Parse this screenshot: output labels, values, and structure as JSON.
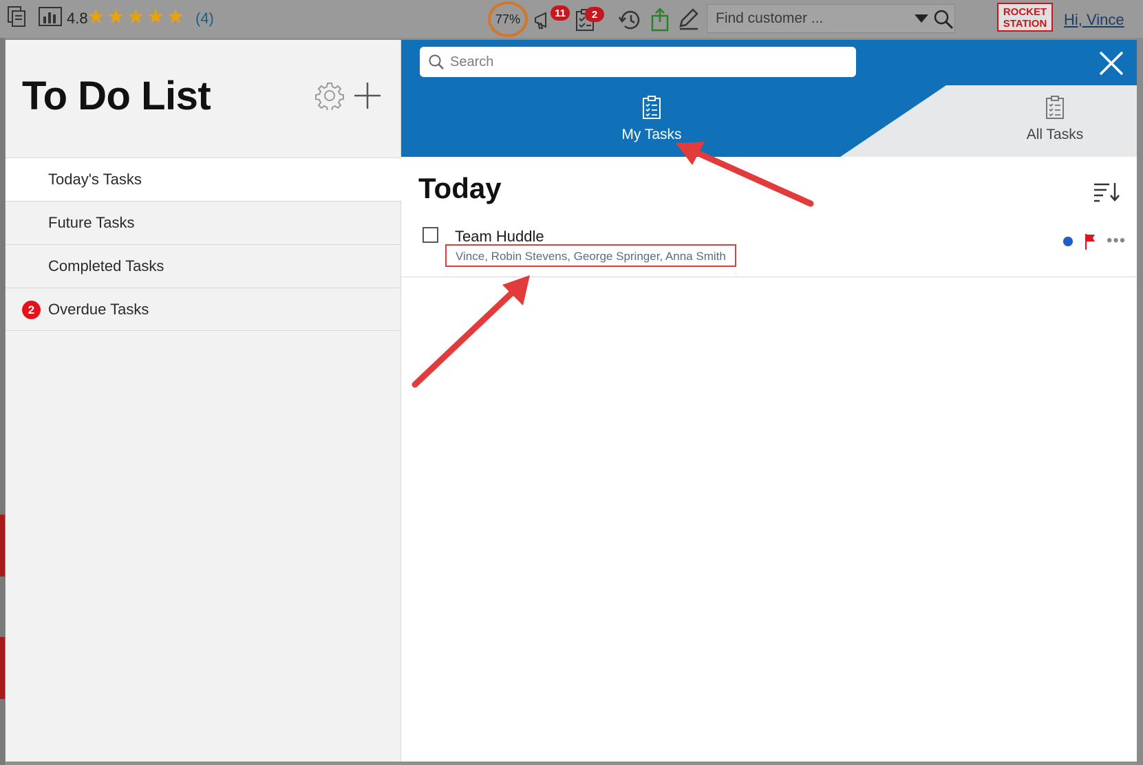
{
  "topbar": {
    "rating_value": "4.8",
    "rating_stars": 5,
    "rating_count": "(4)",
    "progress_label": "77%",
    "notifications_badge": "11",
    "tasks_badge": "2",
    "find_placeholder": "Find customer ...",
    "logo_line1": "ROCKET",
    "logo_line2": "STATION",
    "greeting": "Hi, Vince"
  },
  "sidebar": {
    "title": "To Do List",
    "items": [
      {
        "label": "Today's Tasks"
      },
      {
        "label": "Future Tasks"
      },
      {
        "label": "Completed Tasks"
      },
      {
        "label": "Overdue Tasks",
        "badge": "2"
      }
    ]
  },
  "main": {
    "search_placeholder": "Search",
    "tabs": [
      {
        "label": "My Tasks",
        "active": true
      },
      {
        "label": "All Tasks",
        "active": false
      }
    ],
    "section_title": "Today",
    "tasks": [
      {
        "title": "Team Huddle",
        "assignees": "Vince, Robin Stevens, George Springer, Anna Smith",
        "dot_color": "#1c5fc9",
        "flag_color": "#e0141d"
      }
    ]
  },
  "colors": {
    "accent_blue": "#1071b8",
    "annotation_red": "#e23b3b",
    "star_gold": "#e8a20c"
  }
}
